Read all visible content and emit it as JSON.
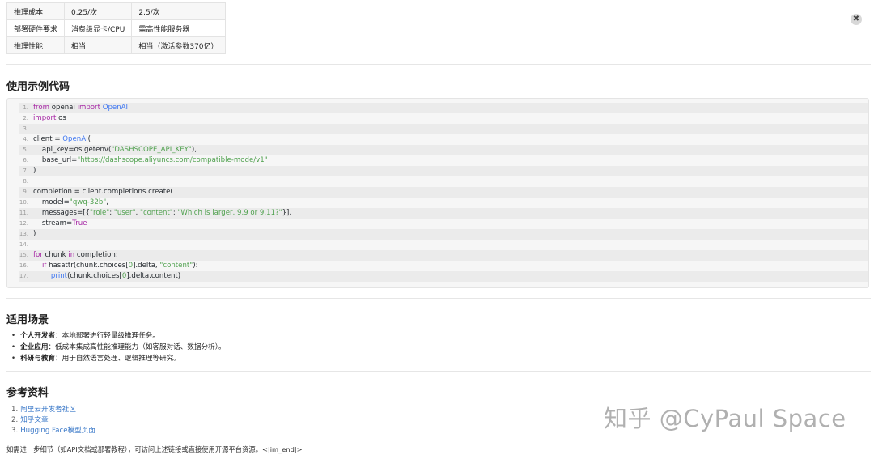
{
  "table": {
    "rows": [
      [
        "推理成本",
        "0.25/次",
        "2.5/次"
      ],
      [
        "部署硬件要求",
        "消费级显卡/CPU",
        "需高性能服务器"
      ],
      [
        "推理性能",
        "相当",
        "相当（激活参数370亿）"
      ]
    ]
  },
  "sections": {
    "code_title": "使用示例代码",
    "scenarios_title": "适用场景",
    "refs_title": "参考资料"
  },
  "code": {
    "lines": [
      {
        "n": "1.",
        "html": "<span class=\"k\">from</span> openai <span class=\"k\">import</span> <span class=\"f\">OpenAI</span>"
      },
      {
        "n": "2.",
        "html": "<span class=\"k\">import</span> os"
      },
      {
        "n": "3.",
        "html": ""
      },
      {
        "n": "4.",
        "html": "client = <span class=\"f\">OpenAI</span>("
      },
      {
        "n": "5.",
        "html": "    api_key=os.getenv(<span class=\"s\">\"DASHSCOPE_API_KEY\"</span>),"
      },
      {
        "n": "6.",
        "html": "    base_url=<span class=\"s\">\"https://dashscope.aliyuncs.com/compatible-mode/v1\"</span>"
      },
      {
        "n": "7.",
        "html": ")"
      },
      {
        "n": "8.",
        "html": ""
      },
      {
        "n": "9.",
        "html": "completion = client.completions.create("
      },
      {
        "n": "10.",
        "html": "    model=<span class=\"s\">\"qwq-32b\"</span>,"
      },
      {
        "n": "11.",
        "html": "    messages=[{<span class=\"s\">\"role\"</span>: <span class=\"s\">\"user\"</span>, <span class=\"s\">\"content\"</span>: <span class=\"s\">\"Which is larger, 9.9 or 9.11?\"</span>}],"
      },
      {
        "n": "12.",
        "html": "    stream=<span class=\"k\">True</span>"
      },
      {
        "n": "13.",
        "html": ")"
      },
      {
        "n": "14.",
        "html": ""
      },
      {
        "n": "15.",
        "html": "<span class=\"k\">for</span> chunk <span class=\"k\">in</span> completion:"
      },
      {
        "n": "16.",
        "html": "    <span class=\"k\">if</span> hasattr(chunk.choices[<span class=\"s\">0</span>].delta, <span class=\"s\">\"content\"</span>):"
      },
      {
        "n": "17.",
        "html": "        <span class=\"f\">print</span>(chunk.choices[<span class=\"s\">0</span>].delta.content)"
      }
    ]
  },
  "scenarios": [
    {
      "label": "个人开发者",
      "text": "：本地部署进行轻量级推理任务。"
    },
    {
      "label": "企业应用",
      "text": "：低成本集成高性能推理能力（如客服对话、数据分析）。"
    },
    {
      "label": "科研与教育",
      "text": "：用于自然语言处理、逻辑推理等研究。"
    }
  ],
  "refs": [
    {
      "n": "1.",
      "label": "阿里云开发者社区"
    },
    {
      "n": "2.",
      "label": "知乎文章"
    },
    {
      "n": "3.",
      "label": "Hugging Face模型页面"
    }
  ],
  "note": "如需进一步细节（如API文档或部署教程），可访问上述链接或直接使用开源平台资源。<|im_end|>",
  "watermark": "知乎 @CyPaul Space",
  "icons": {
    "close": "close-icon"
  },
  "colors": {
    "link": "#3a78c8",
    "keyword": "#a626a4",
    "string": "#50a14f",
    "function": "#4078f2"
  }
}
